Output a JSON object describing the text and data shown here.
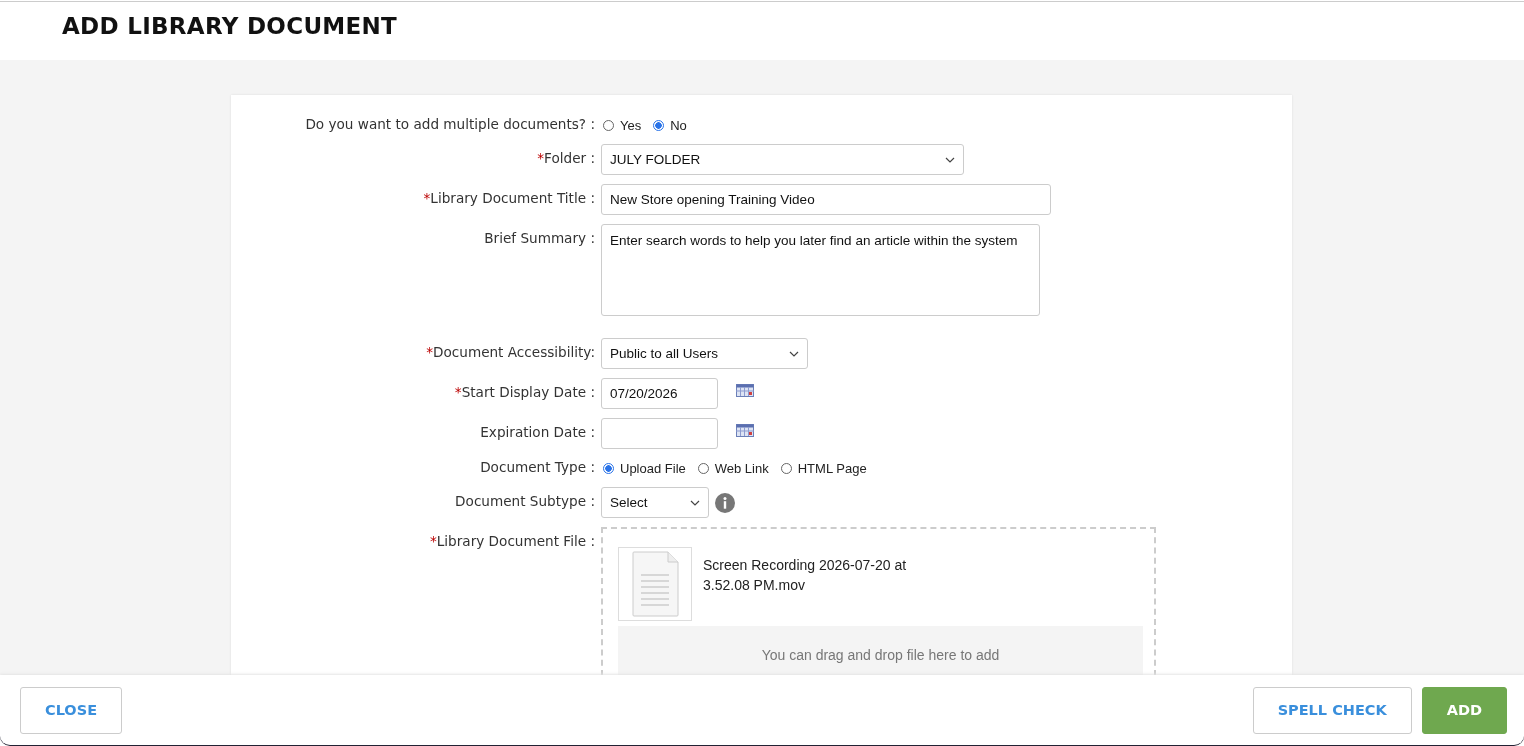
{
  "title": "ADD LIBRARY DOCUMENT",
  "fields": [
    {
      "kind": "radio",
      "label": "Do you want to add multiple documents? :",
      "options": [
        {
          "label": "Yes",
          "selected": false
        },
        {
          "label": "No",
          "selected": true
        }
      ]
    },
    {
      "kind": "select",
      "required_mark": "*",
      "label": "Folder :",
      "value": "JULY FOLDER"
    },
    {
      "kind": "text",
      "required_mark": "*",
      "label": "Library Document Title :",
      "value": "New Store opening Training Video"
    },
    {
      "kind": "textarea",
      "label": "Brief Summary :",
      "value": "Enter search words to help you later find an article within the system"
    },
    {
      "kind": "select",
      "required_mark": "*",
      "label": "Document Accessibility:",
      "value": "Public to all Users"
    },
    {
      "kind": "date",
      "required_mark": "*",
      "label": "Start Display Date :",
      "value": "07/20/2026"
    },
    {
      "kind": "date",
      "label": "Expiration Date :"
    },
    {
      "kind": "radio",
      "label": "Document Type :",
      "options": [
        {
          "label": "Upload File",
          "selected": true
        },
        {
          "label": "Web Link",
          "selected": false
        },
        {
          "label": "HTML Page",
          "selected": false
        }
      ]
    },
    {
      "kind": "select",
      "label": "Document Subtype :",
      "value": "Select",
      "info": true
    },
    {
      "kind": "file",
      "required_mark": "*",
      "label": "Library Document File :",
      "file_name": "Screen Recording 2026-07-20 at 3.52.08 PM.mov",
      "drop_hint": "You can drag and drop file here to add"
    }
  ],
  "footer": {
    "left_buttons": [
      {
        "label": "CLOSE",
        "kind": "outline"
      }
    ],
    "right_buttons": [
      {
        "label": "SPELL CHECK",
        "kind": "outline"
      },
      {
        "label": "ADD",
        "kind": "primary"
      }
    ]
  }
}
